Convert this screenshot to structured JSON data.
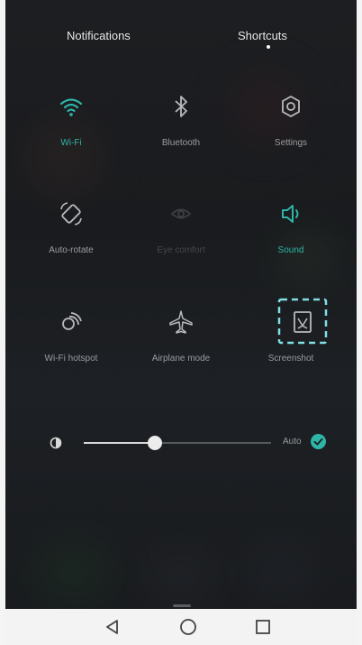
{
  "tabs": {
    "notifications": "Notifications",
    "shortcuts": "Shortcuts",
    "active": "Shortcuts"
  },
  "shortcuts": [
    {
      "label": "Wi-Fi",
      "icon": "wifi-icon",
      "state": "active"
    },
    {
      "label": "Bluetooth",
      "icon": "bluetooth-icon",
      "state": "off"
    },
    {
      "label": "Settings",
      "icon": "gear-icon",
      "state": "off"
    },
    {
      "label": "Auto-rotate",
      "icon": "rotate-icon",
      "state": "off"
    },
    {
      "label": "Eye comfort",
      "icon": "eye-comfort-icon",
      "state": "disabled"
    },
    {
      "label": "Sound",
      "icon": "speaker-icon",
      "state": "active"
    },
    {
      "label": "Wi-Fi hotspot",
      "icon": "hotspot-icon",
      "state": "off"
    },
    {
      "label": "Airplane mode",
      "icon": "airplane-icon",
      "state": "off"
    },
    {
      "label": "Screenshot",
      "icon": "screenshot-icon",
      "state": "highlighted"
    }
  ],
  "brightness": {
    "level": 0.38,
    "auto_label": "Auto",
    "auto_enabled": true
  },
  "colors": {
    "accent": "#2fb5a8",
    "background": "#1c1e21",
    "label": "#9a9ca0"
  },
  "navbar": [
    "back-icon",
    "home-icon",
    "recents-icon"
  ]
}
